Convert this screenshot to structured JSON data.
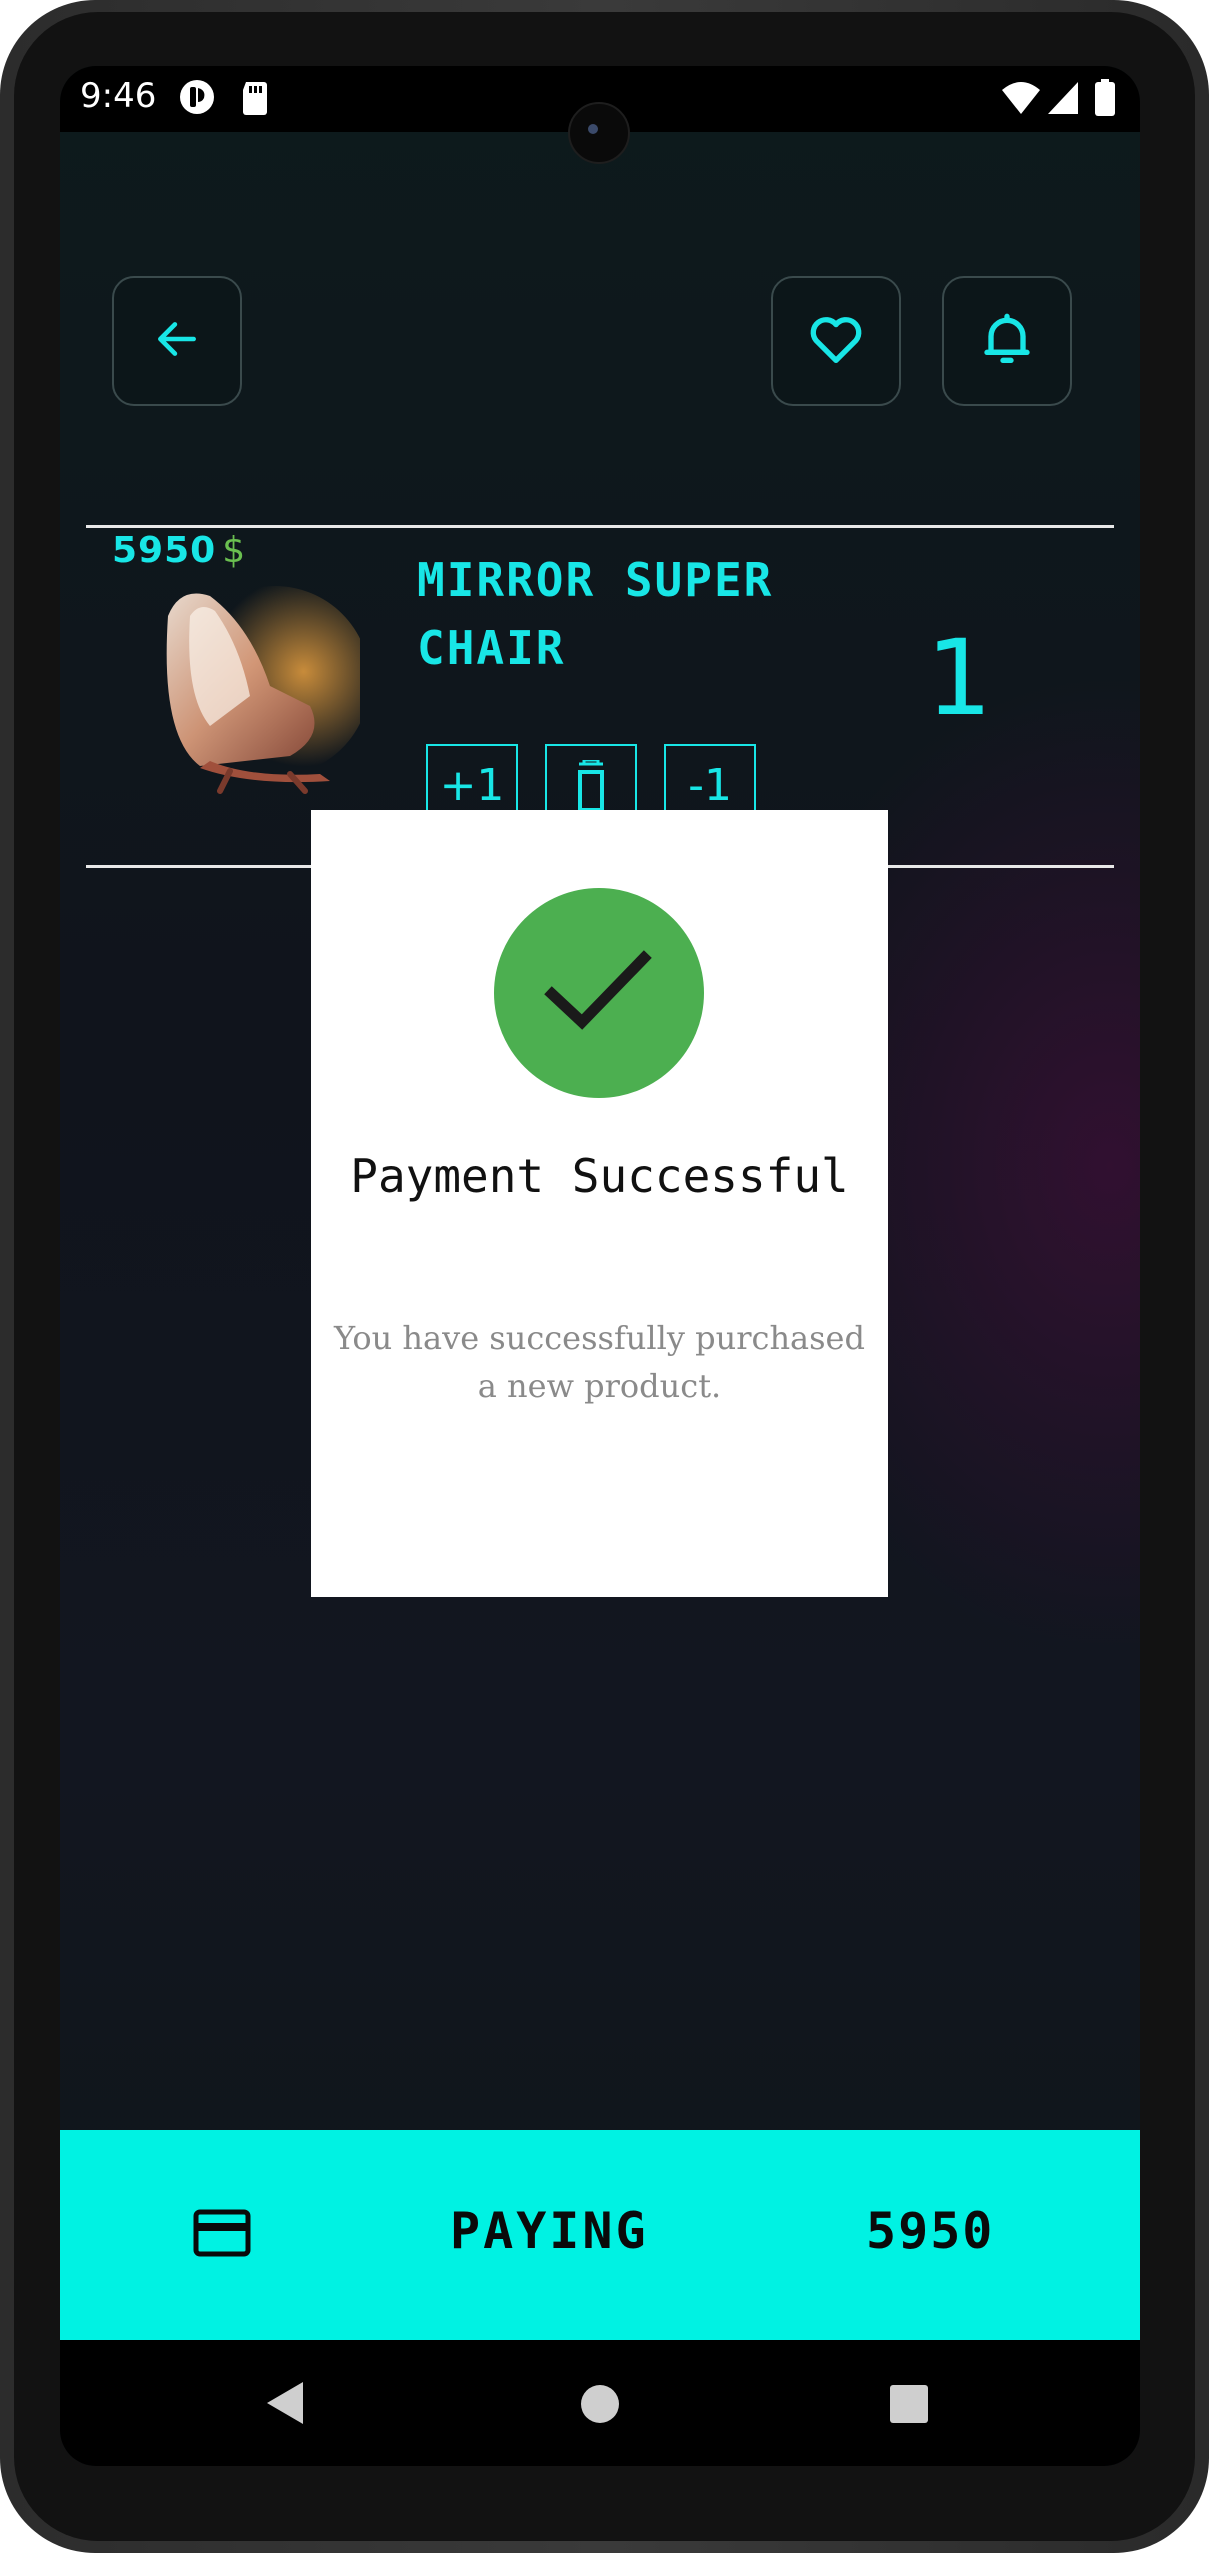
{
  "status_bar": {
    "time": "9:46"
  },
  "header": {
    "back_icon": "arrow-left-icon",
    "favorite_icon": "heart-icon",
    "notification_icon": "bell-icon"
  },
  "cart_item": {
    "price": "5950",
    "currency": "$",
    "name": "Mirror Super Chair",
    "quantity": "1",
    "increment_label": "+1",
    "delete_icon": "trash-icon",
    "decrement_label": "-1"
  },
  "dialog": {
    "icon": "check-icon",
    "title": "Payment Successful",
    "message": "You have successfully purchased a new product."
  },
  "pay_bar": {
    "icon": "credit-card-icon",
    "label": "PAYING",
    "total": "5950"
  },
  "colors": {
    "accent": "#18e6e6",
    "pay_bar": "#00f2e3",
    "success": "#4caf50",
    "currency": "#6abf50"
  }
}
